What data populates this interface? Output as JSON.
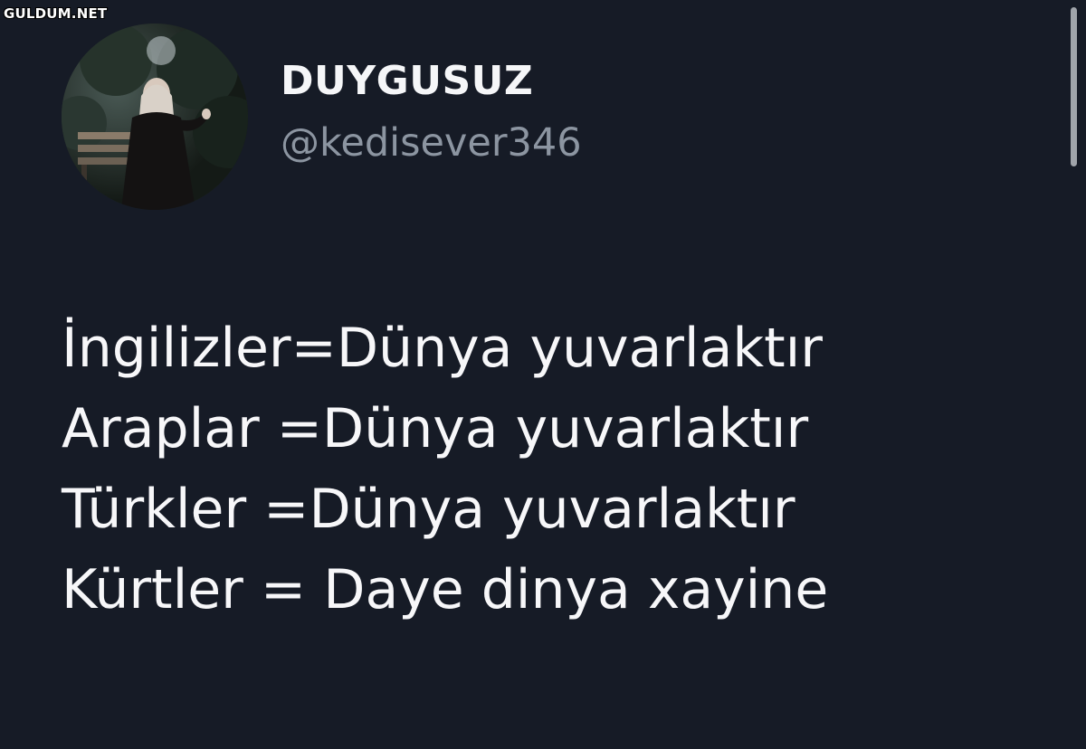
{
  "watermark": "GULDUM.NET",
  "profile": {
    "display_name": "DUYGUSUZ",
    "handle": "@kedisever346",
    "avatar_icon": "profile-photo"
  },
  "tweet": {
    "lines": [
      "İngilizler=Dünya yuvarlaktır",
      "Araplar =Dünya yuvarlaktır",
      "Türkler =Dünya yuvarlaktır",
      "Kürtler = Daye dinya xayine"
    ]
  },
  "colors": {
    "background": "#161b26",
    "text": "#f7f7f9",
    "handle": "#8c95a1"
  }
}
